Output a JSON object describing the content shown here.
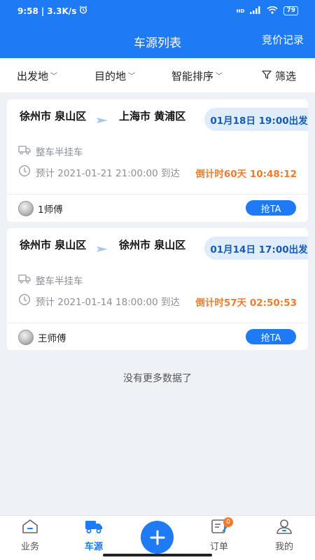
{
  "status": {
    "time": "9:58",
    "speed": "3.3K/s",
    "battery": "79",
    "hd": "HD"
  },
  "header": {
    "title": "车源列表",
    "right_link": "竞价记录"
  },
  "filters": {
    "origin": "出发地",
    "destination": "目的地",
    "sort": "智能排序",
    "filter": "筛选"
  },
  "cards": [
    {
      "from": "徐州市 泉山区",
      "to": "上海市 黄浦区",
      "depart": "01月18日 19:00出发",
      "vehicle": "整车半挂车",
      "eta": "预计 2021-01-21 21:00:00 到达",
      "countdown": "倒计时60天 10:48:12",
      "driver": "1师傅",
      "action": "抢TA"
    },
    {
      "from": "徐州市 泉山区",
      "to": "徐州市 泉山区",
      "depart": "01月14日 17:00出发",
      "vehicle": "整车半挂车",
      "eta": "预计 2021-01-14 18:00:00 到达",
      "countdown": "倒计时57天 02:50:53",
      "driver": "王师傅",
      "action": "抢TA"
    }
  ],
  "footer_note": "没有更多数据了",
  "nav": {
    "business": "业务",
    "cars": "车源",
    "orders": "订单",
    "orders_badge": "0",
    "mine": "我的"
  },
  "colors": {
    "primary": "#1e7af5",
    "countdown": "#f07c2b",
    "depart_bg": "#dfecfb"
  }
}
